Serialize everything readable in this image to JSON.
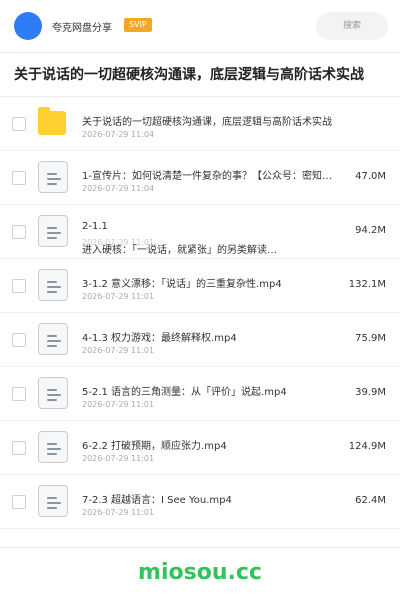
{
  "header": {
    "app_name": "夸克网盘分享",
    "badge": "SVIP",
    "search_placeholder": "搜索"
  },
  "title": "关于说话的一切超硬核沟通课，底层逻辑与高阶话术实战",
  "files": [
    {
      "type": "folder",
      "name": "关于说话的一切超硬核沟通课，底层逻辑与高阶话术实战",
      "date": "2026-07-29 11:04",
      "size": ""
    },
    {
      "type": "file",
      "name": "1-宣传片：如何说清楚一件复杂的事？【公众号：密知…",
      "date": "2026-07-29 11:04",
      "size": "47.0M"
    },
    {
      "type": "file",
      "name": "2-1.1",
      "name2": "进入硬核：「一说话，就紧张」的另类解读…",
      "date": "2026-07-29 11:01",
      "size": "94.2M"
    },
    {
      "type": "file",
      "name": "3-1.2 意义漂移：「说话」的三重复杂性.mp4",
      "date": "2026-07-29 11:01",
      "size": "132.1M"
    },
    {
      "type": "file",
      "name": "4-1.3 权力游戏：最终解释权.mp4",
      "date": "2026-07-29 11:01",
      "size": "75.9M"
    },
    {
      "type": "file",
      "name": "5-2.1 语言的三角测量：从「评价」说起.mp4",
      "date": "2026-07-29 11:01",
      "size": "39.9M"
    },
    {
      "type": "file",
      "name": "6-2.2 打破预期，顺应张力.mp4",
      "date": "2026-07-29 11:01",
      "size": "124.9M"
    },
    {
      "type": "file",
      "name": "7-2.3 超越语言：I See You.mp4",
      "date": "2026-07-29 11:01",
      "size": "62.4M"
    }
  ],
  "footer": {
    "watermark": "miosou.cc"
  },
  "colors": {
    "accent": "#2f7df6",
    "badge": "#f5a623",
    "folder": "#ffcf2f",
    "watermark": "#33c35b"
  }
}
